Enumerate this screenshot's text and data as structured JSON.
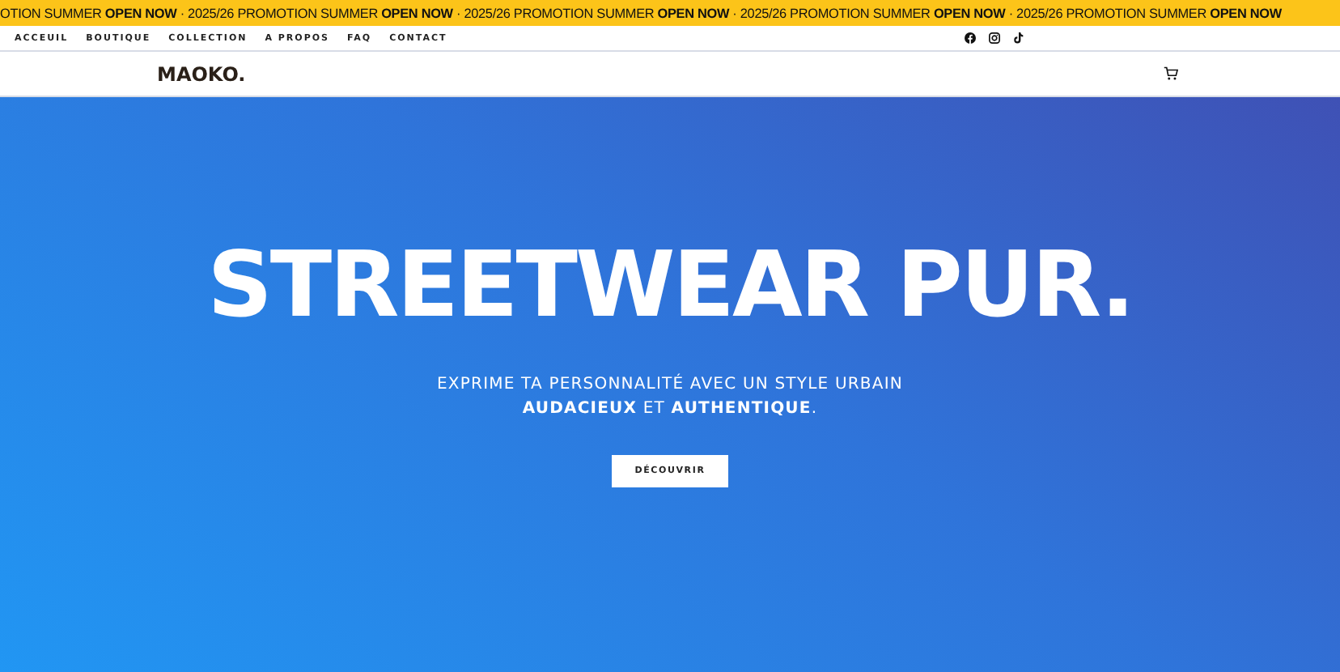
{
  "promo_bar": {
    "text": "OTION SUMMER **OPEN NOW** · 2025/26 PROMOTION SUMMER **OPEN NOW** · 2025/26 PROMOTION SUMMER **OPEN NOW** · 2025/26 PROMOTION SUMMER **OPEN NOW** · 2025/26 PROMOTION SUMMER **OPEN NOW**"
  },
  "nav": {
    "links": [
      "ACCEUIL",
      "BOUTIQUE",
      "COLLECTION",
      "A PROPOS",
      "FAQ",
      "CONTACT"
    ]
  },
  "header": {
    "logo": "MAOKO."
  },
  "hero": {
    "title": "STREETWEAR PUR.",
    "subtitle_line_1": "EXPRIME TA PERSONNALITÉ AVEC UN STYLE URBAIN",
    "subtitle_line_2": "**AUDACIEUX** ET **AUTHENTIQUE**.",
    "button": "DÉCOUVRIR"
  }
}
